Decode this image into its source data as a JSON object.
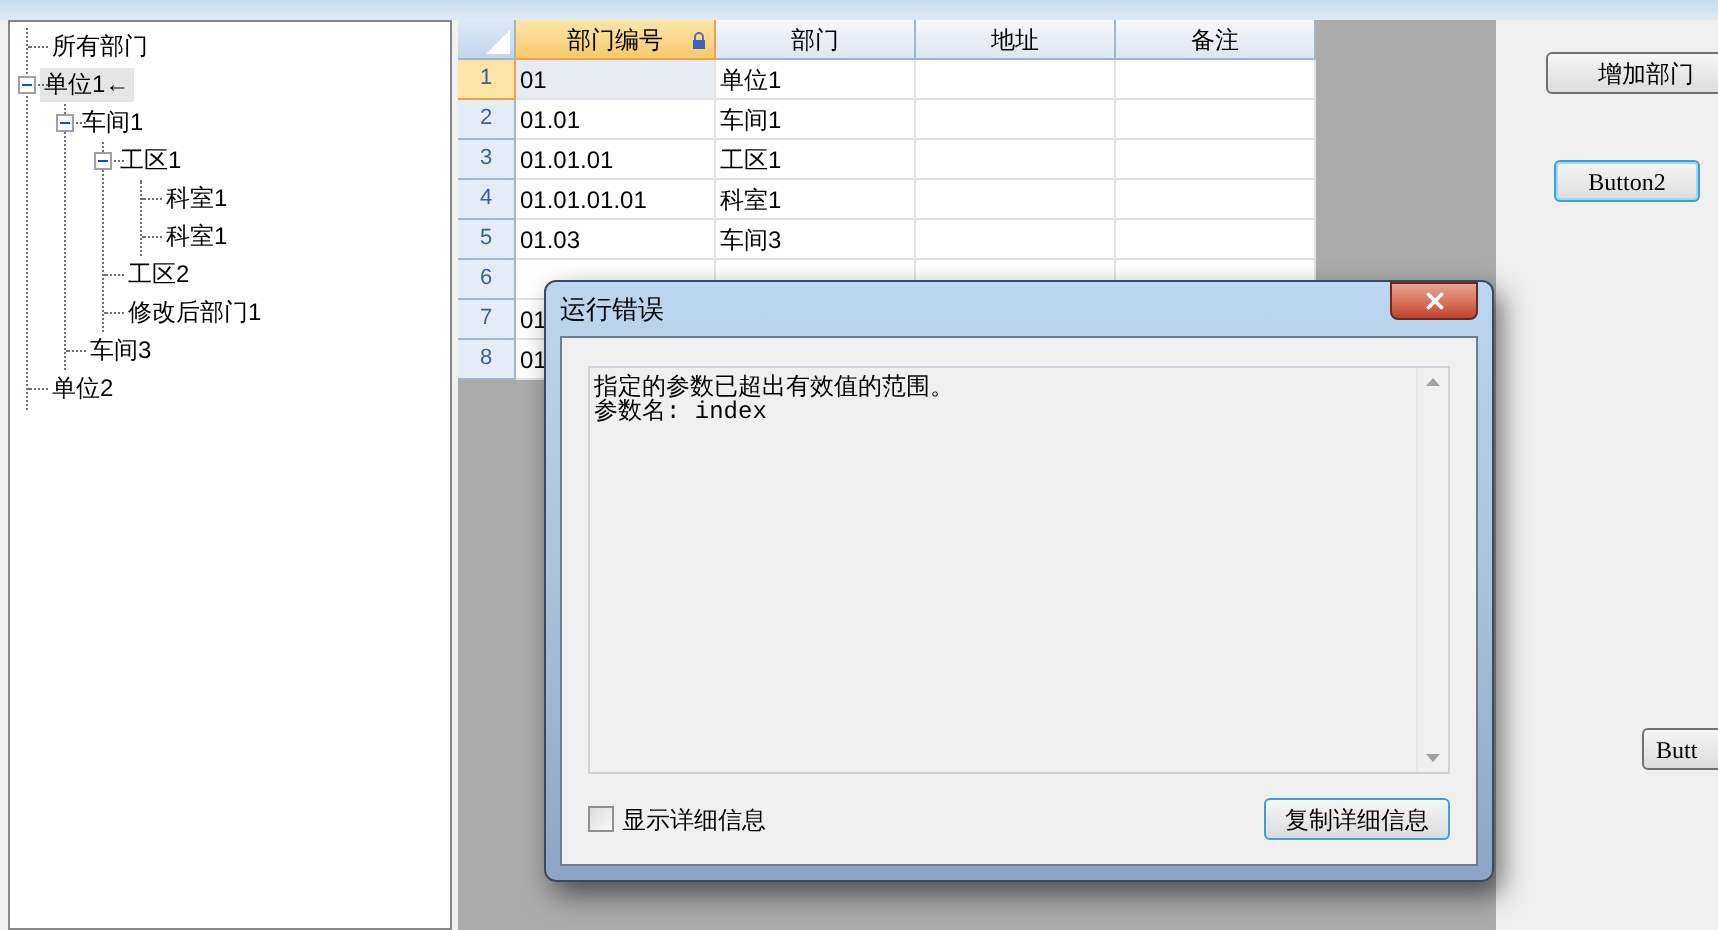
{
  "tree": [
    {
      "label": "所有部门",
      "selected": false
    },
    {
      "label": "单位1←",
      "selected": true,
      "expanded": true,
      "children": [
        {
          "label": "车间1",
          "selected": false,
          "expanded": true,
          "children": [
            {
              "label": "工区1",
              "selected": false,
              "expanded": true,
              "children": [
                {
                  "label": "科室1",
                  "selected": false
                },
                {
                  "label": "科室1",
                  "selected": false
                }
              ]
            },
            {
              "label": "工区2",
              "selected": false
            },
            {
              "label": "修改后部门1",
              "selected": false
            }
          ]
        },
        {
          "label": "车间3",
          "selected": false
        }
      ]
    },
    {
      "label": "单位2",
      "selected": false
    }
  ],
  "grid": {
    "columns": [
      {
        "label": "部门编号",
        "selected": true,
        "locked": true
      },
      {
        "label": "部门",
        "selected": false,
        "locked": false
      },
      {
        "label": "地址",
        "selected": false,
        "locked": false
      },
      {
        "label": "备注",
        "selected": false,
        "locked": false
      }
    ],
    "rows": [
      {
        "number": "1",
        "selected": true,
        "cells": [
          "01",
          "单位1",
          "",
          ""
        ]
      },
      {
        "number": "2",
        "selected": false,
        "cells": [
          "01.01",
          "车间1",
          "",
          ""
        ]
      },
      {
        "number": "3",
        "selected": false,
        "cells": [
          "01.01.01",
          "工区1",
          "",
          ""
        ]
      },
      {
        "number": "4",
        "selected": false,
        "cells": [
          "01.01.01.01",
          "科室1",
          "",
          ""
        ]
      },
      {
        "number": "5",
        "selected": false,
        "cells": [
          "01.03",
          "车间3",
          "",
          ""
        ]
      },
      {
        "number": "6",
        "selected": false,
        "cells": [
          "",
          "",
          "",
          ""
        ]
      },
      {
        "number": "7",
        "selected": false,
        "cells": [
          "01"
        ]
      },
      {
        "number": "8",
        "selected": false,
        "cells": [
          "01"
        ]
      }
    ]
  },
  "buttons": [
    {
      "label": "增加部门",
      "focused": false
    },
    {
      "label": "Button2",
      "focused": true
    },
    {
      "label": "Butt",
      "focused": false
    }
  ],
  "dialog": {
    "title": "运行错误",
    "message": [
      "指定的参数已超出有效值的范围。",
      "参数名: index"
    ],
    "checkbox": {
      "label": "显示详细信息",
      "checked": false
    },
    "button": "复制详细信息"
  }
}
